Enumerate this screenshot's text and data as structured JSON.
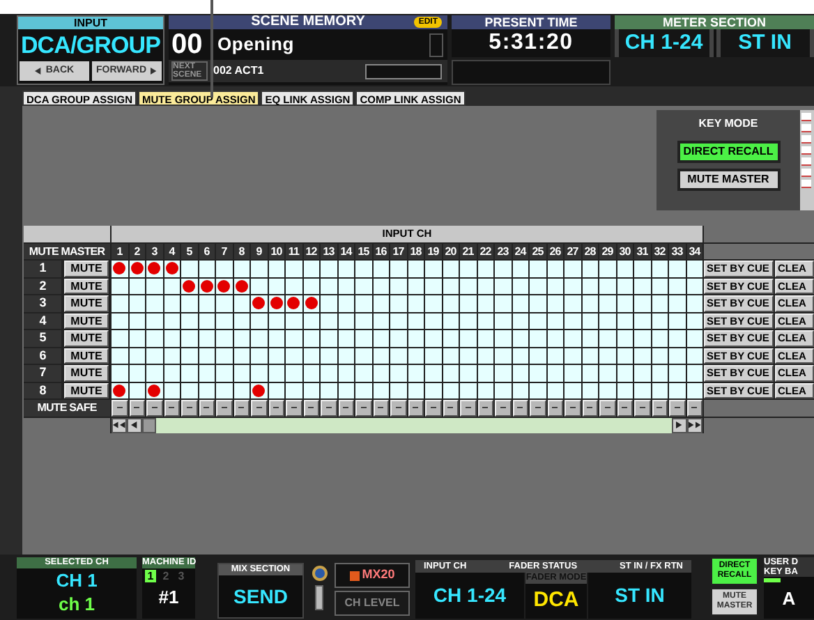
{
  "input_panel": {
    "title": "INPUT",
    "value": "DCA/GROUP",
    "buttons": [
      {
        "label": "BACK",
        "kind": "back"
      },
      {
        "label": "FORWARD",
        "kind": "forward"
      }
    ]
  },
  "scene_memory": {
    "title": "SCENE MEMORY",
    "badge": "EDIT",
    "number": "00",
    "name": "Opening",
    "next_label": "NEXT SCENE",
    "next_scene": "002 ACT1"
  },
  "present_time": {
    "title": "PRESENT TIME",
    "value": "5:31:20"
  },
  "meter_section": {
    "title": "METER SECTION",
    "options": [
      "CH 1-24",
      "ST IN"
    ]
  },
  "tabs": [
    {
      "label": "DCA GROUP ASSIGN",
      "selected": false
    },
    {
      "label": "MUTE GROUP ASSIGN",
      "selected": true
    },
    {
      "label": "EQ LINK ASSIGN",
      "selected": false
    },
    {
      "label": "COMP LINK ASSIGN",
      "selected": false
    }
  ],
  "key_mode": {
    "title": "KEY MODE",
    "options": [
      {
        "label": "DIRECT RECALL",
        "selected": true
      },
      {
        "label": "MUTE MASTER",
        "selected": false
      }
    ]
  },
  "grid": {
    "corner_label": "MUTE MASTER",
    "group_label": "INPUT CH",
    "mute_safe_label": "MUTE SAFE",
    "channels": [
      "1",
      "2",
      "3",
      "4",
      "5",
      "6",
      "7",
      "8",
      "9",
      "10",
      "11",
      "12",
      "13",
      "14",
      "15",
      "16",
      "17",
      "18",
      "19",
      "20",
      "21",
      "22",
      "23",
      "24",
      "25",
      "26",
      "27",
      "28",
      "29",
      "30",
      "31",
      "32",
      "33",
      "34"
    ],
    "rows": [
      {
        "number": "1",
        "button": "MUTE",
        "actions": [
          "SET BY CUE",
          "CLEA"
        ],
        "cells": [
          true,
          true,
          true,
          true,
          false,
          false,
          false,
          false,
          false,
          false,
          false,
          false,
          false,
          false,
          false,
          false,
          false,
          false,
          false,
          false,
          false,
          false,
          false,
          false,
          false,
          false,
          false,
          false,
          false,
          false,
          false,
          false,
          false,
          false
        ]
      },
      {
        "number": "2",
        "button": "MUTE",
        "actions": [
          "SET BY CUE",
          "CLEA"
        ],
        "cells": [
          false,
          false,
          false,
          false,
          true,
          true,
          true,
          true,
          false,
          false,
          false,
          false,
          false,
          false,
          false,
          false,
          false,
          false,
          false,
          false,
          false,
          false,
          false,
          false,
          false,
          false,
          false,
          false,
          false,
          false,
          false,
          false,
          false,
          false
        ]
      },
      {
        "number": "3",
        "button": "MUTE",
        "actions": [
          "SET BY CUE",
          "CLEA"
        ],
        "cells": [
          false,
          false,
          false,
          false,
          false,
          false,
          false,
          false,
          true,
          true,
          true,
          true,
          false,
          false,
          false,
          false,
          false,
          false,
          false,
          false,
          false,
          false,
          false,
          false,
          false,
          false,
          false,
          false,
          false,
          false,
          false,
          false,
          false,
          false
        ]
      },
      {
        "number": "4",
        "button": "MUTE",
        "actions": [
          "SET BY CUE",
          "CLEA"
        ],
        "cells": [
          false,
          false,
          false,
          false,
          false,
          false,
          false,
          false,
          false,
          false,
          false,
          false,
          false,
          false,
          false,
          false,
          false,
          false,
          false,
          false,
          false,
          false,
          false,
          false,
          false,
          false,
          false,
          false,
          false,
          false,
          false,
          false,
          false,
          false
        ]
      },
      {
        "number": "5",
        "button": "MUTE",
        "actions": [
          "SET BY CUE",
          "CLEA"
        ],
        "cells": [
          false,
          false,
          false,
          false,
          false,
          false,
          false,
          false,
          false,
          false,
          false,
          false,
          false,
          false,
          false,
          false,
          false,
          false,
          false,
          false,
          false,
          false,
          false,
          false,
          false,
          false,
          false,
          false,
          false,
          false,
          false,
          false,
          false,
          false
        ]
      },
      {
        "number": "6",
        "button": "MUTE",
        "actions": [
          "SET BY CUE",
          "CLEA"
        ],
        "cells": [
          false,
          false,
          false,
          false,
          false,
          false,
          false,
          false,
          false,
          false,
          false,
          false,
          false,
          false,
          false,
          false,
          false,
          false,
          false,
          false,
          false,
          false,
          false,
          false,
          false,
          false,
          false,
          false,
          false,
          false,
          false,
          false,
          false,
          false
        ]
      },
      {
        "number": "7",
        "button": "MUTE",
        "actions": [
          "SET BY CUE",
          "CLEA"
        ],
        "cells": [
          false,
          false,
          false,
          false,
          false,
          false,
          false,
          false,
          false,
          false,
          false,
          false,
          false,
          false,
          false,
          false,
          false,
          false,
          false,
          false,
          false,
          false,
          false,
          false,
          false,
          false,
          false,
          false,
          false,
          false,
          false,
          false,
          false,
          false
        ]
      },
      {
        "number": "8",
        "button": "MUTE",
        "actions": [
          "SET BY CUE",
          "CLEA"
        ],
        "cells": [
          true,
          false,
          true,
          false,
          false,
          false,
          false,
          false,
          true,
          false,
          false,
          false,
          false,
          false,
          false,
          false,
          false,
          false,
          false,
          false,
          false,
          false,
          false,
          false,
          false,
          false,
          false,
          false,
          false,
          false,
          false,
          false,
          false,
          false
        ]
      }
    ]
  },
  "bottom": {
    "selected_ch": {
      "title": "SELECTED CH",
      "value": "CH 1",
      "name": "ch 1"
    },
    "machine_id": {
      "title": "MACHINE ID",
      "options": [
        {
          "label": "1",
          "selected": true
        },
        {
          "label": "2",
          "selected": false
        },
        {
          "label": "3",
          "selected": false
        }
      ],
      "value": "#1"
    },
    "mix_section": {
      "title": "MIX SECTION",
      "value": "SEND"
    },
    "mix_target": {
      "value": "MX20",
      "mode": "CH LEVEL"
    },
    "fader_status": {
      "left_title": "INPUT CH",
      "title": "FADER STATUS",
      "right_title": "ST IN / FX RTN",
      "left_value": "CH 1-24",
      "mode_title": "FADER MODE",
      "mode_value": "DCA",
      "right_value": "ST IN"
    },
    "key_buttons": [
      {
        "label": "DIRECT RECALL",
        "selected": true
      },
      {
        "label": "MUTE MASTER",
        "selected": false
      }
    ],
    "user_key": {
      "title_lines": [
        "USER D",
        "KEY BA"
      ],
      "value": "A"
    }
  }
}
